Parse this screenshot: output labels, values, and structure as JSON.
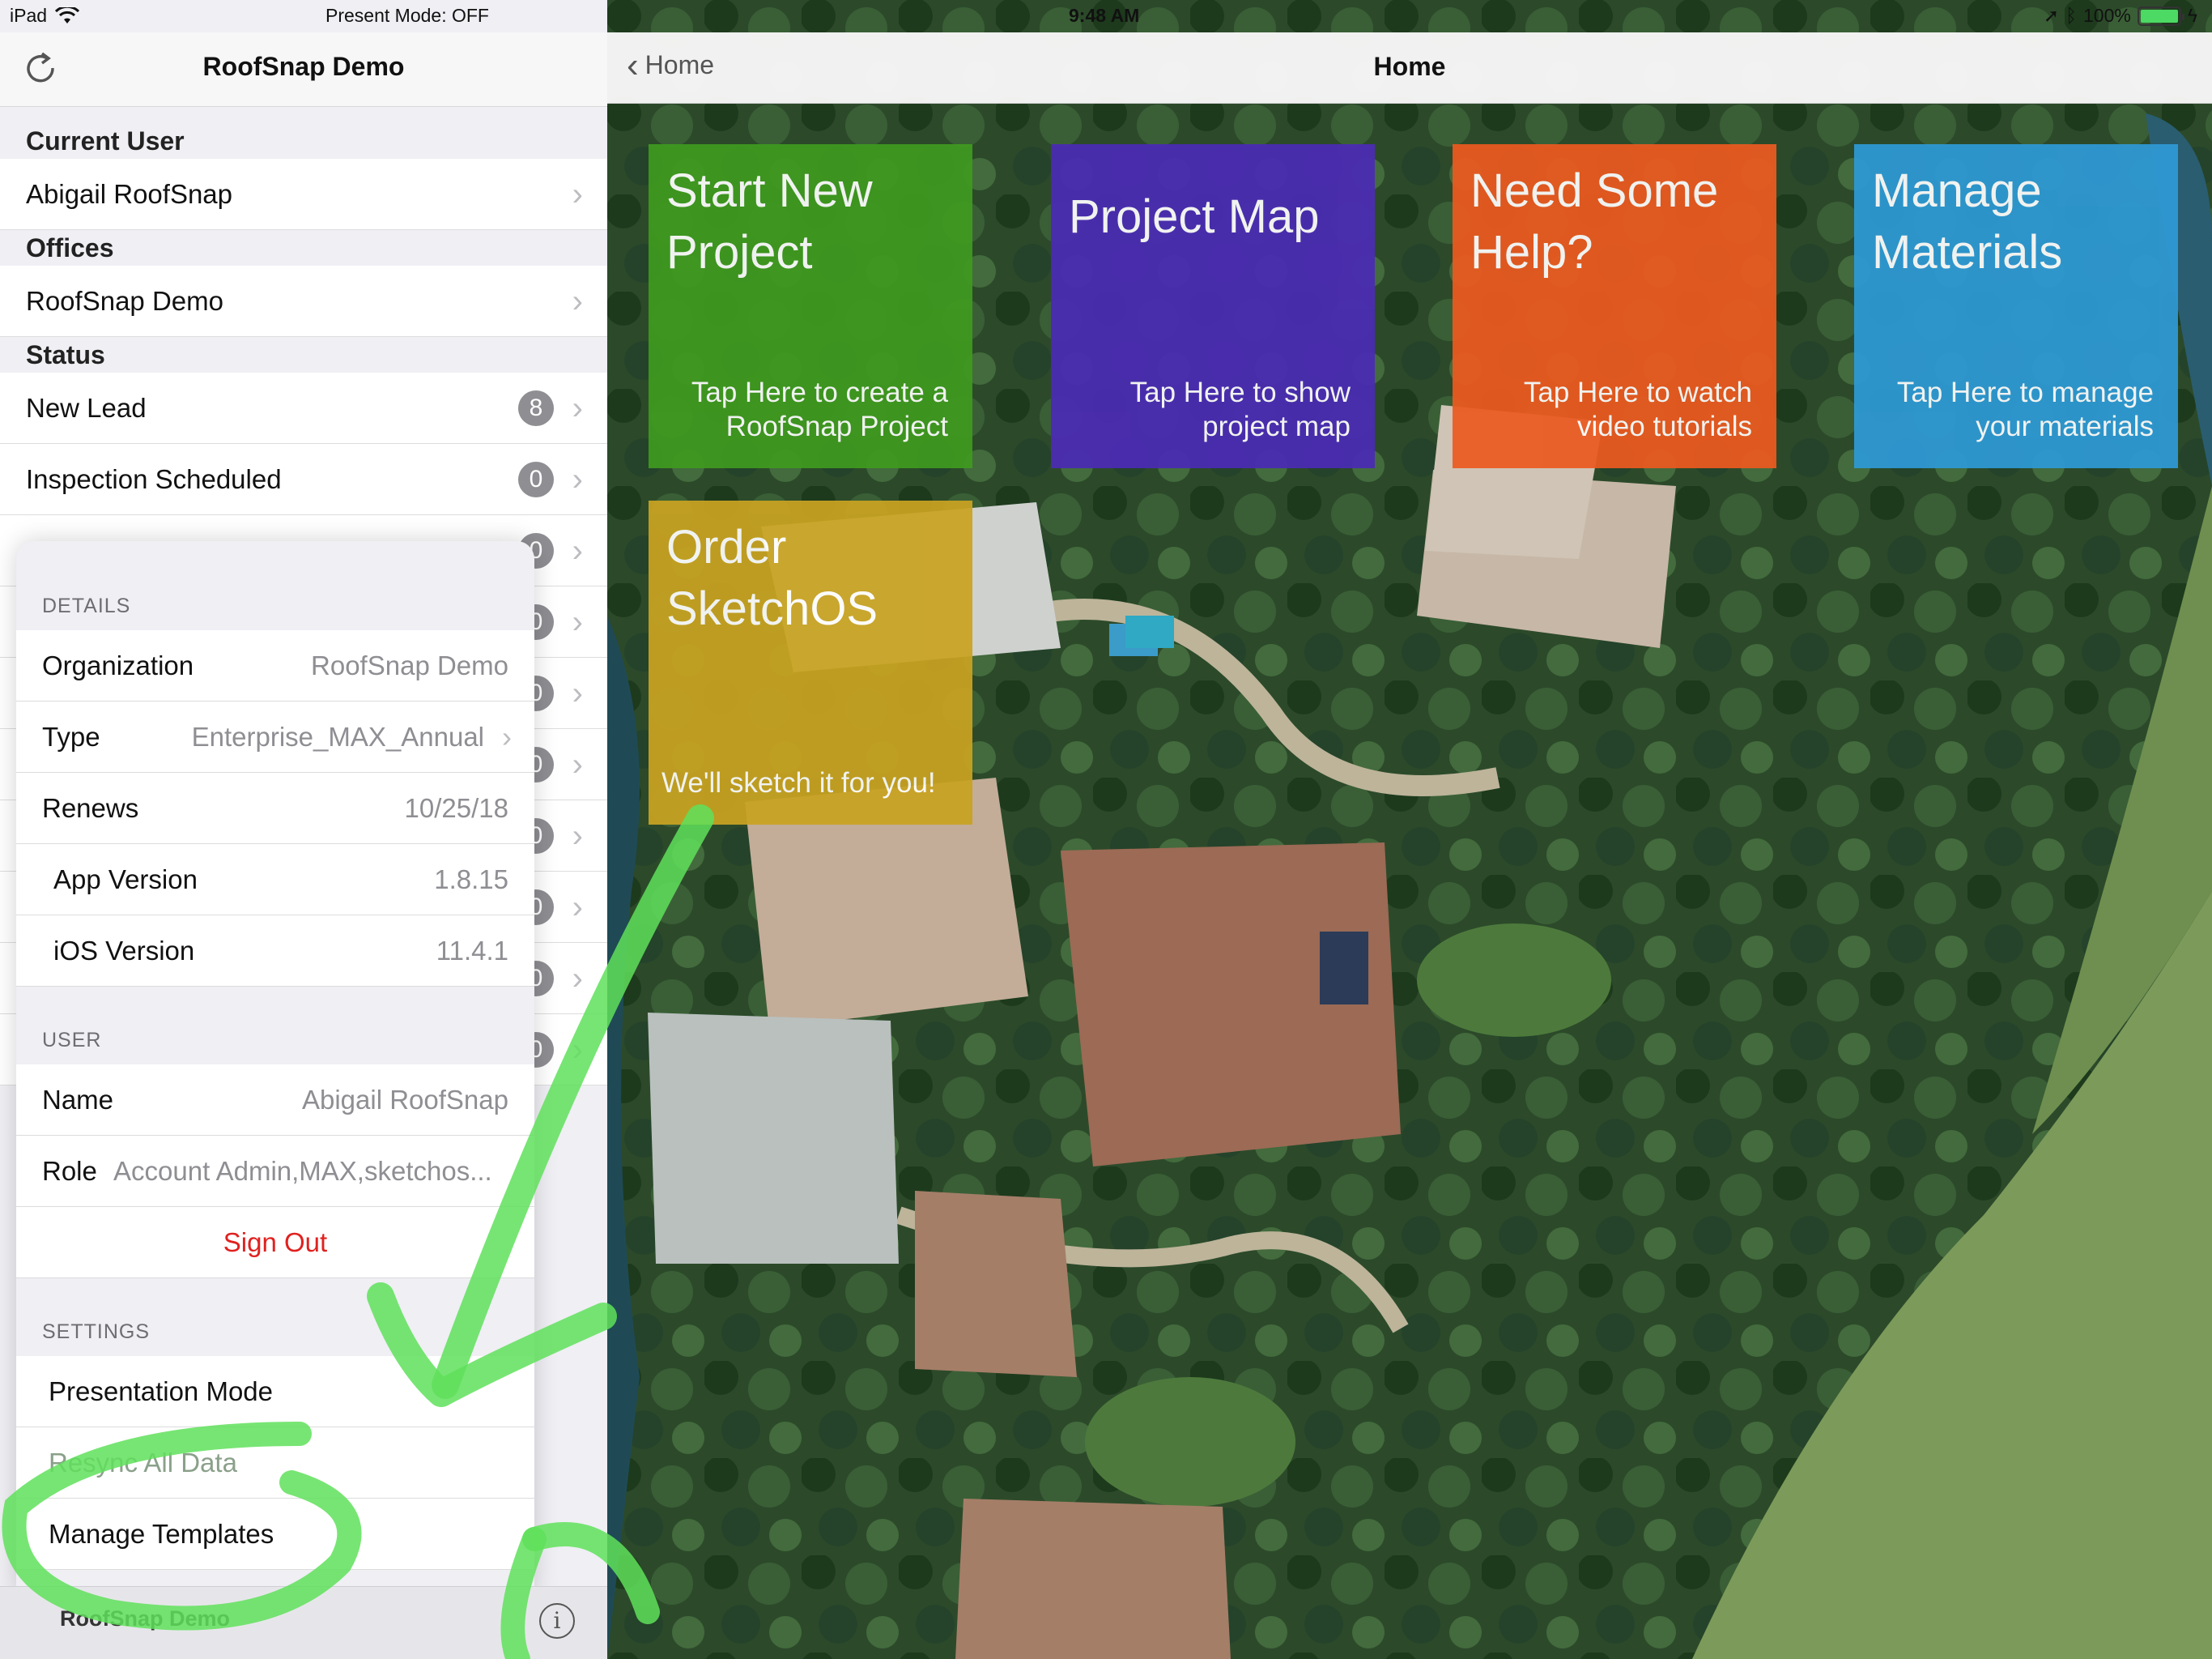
{
  "status_bar": {
    "device": "iPad",
    "present_mode": "Present Mode: OFF",
    "time": "9:48 AM",
    "battery": "100%"
  },
  "master": {
    "title": "RoofSnap Demo",
    "sections": {
      "current_user": "Current User",
      "offices": "Offices",
      "status": "Status"
    },
    "current_user": "Abigail RoofSnap",
    "office": "RoofSnap Demo",
    "status_items": [
      {
        "label": "New Lead",
        "count": "8"
      },
      {
        "label": "Inspection Scheduled",
        "count": "0"
      }
    ],
    "hidden_counts": [
      "0",
      "0",
      "0",
      "0",
      "0",
      "0",
      "0",
      "0"
    ]
  },
  "popover": {
    "details_header": "DETAILS",
    "details": [
      {
        "label": "Organization",
        "value": "RoofSnap Demo"
      },
      {
        "label": "Type",
        "value": "Enterprise_MAX_Annual"
      },
      {
        "label": "Renews",
        "value": "10/25/18"
      },
      {
        "label": "App Version",
        "value": "1.8.15"
      },
      {
        "label": "iOS Version",
        "value": "11.4.1"
      }
    ],
    "user_header": "USER",
    "user": {
      "name_label": "Name",
      "name_value": "Abigail RoofSnap",
      "role_label": "Role",
      "role_value": "Account Admin,MAX,sketchos..."
    },
    "sign_out": "Sign Out",
    "settings_header": "SETTINGS",
    "settings": [
      "Presentation Mode",
      "Resync All Data",
      "Manage Templates"
    ]
  },
  "toolbar": {
    "org": "RoofSnap Demo",
    "info_glyph": "i"
  },
  "detail": {
    "back_label": "Home",
    "title": "Home",
    "tiles": [
      {
        "title": "Start New Project",
        "sub": "Tap Here to create a RoofSnap Project",
        "color": "#3f9a1f"
      },
      {
        "title": "Project Map",
        "sub": "Tap Here to show project map",
        "color": "#4b2bb5"
      },
      {
        "title": "Need Some Help?",
        "sub": "Tap Here to watch video tutorials",
        "color": "#ec5a20"
      },
      {
        "title": "Manage Materials",
        "sub": "Tap Here to manage your materials",
        "color": "#2e9ad6"
      },
      {
        "title": "Order SketchOS",
        "sub": "We'll sketch it for you!",
        "color": "#c9a321"
      }
    ]
  },
  "colors": {
    "accent_red": "#e0211f",
    "annotation_green": "#5fe05a"
  }
}
